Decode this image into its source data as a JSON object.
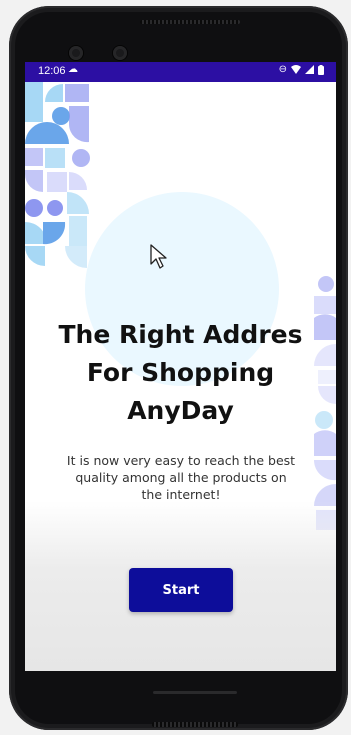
{
  "status_bar": {
    "time": "12:06",
    "left_icons": [
      "cloud-icon"
    ],
    "right_icons": [
      "do-not-disturb-icon",
      "wifi-icon",
      "signal-icon",
      "battery-icon"
    ],
    "background": "#2c0fa3"
  },
  "onboarding": {
    "title_lines": [
      "The Right Addres",
      "For Shopping",
      "AnyDay"
    ],
    "subtitle": "It is now very easy to reach the best quality among all the products on the internet!",
    "start_button_label": "Start"
  },
  "colors": {
    "accent": "#0d0d9a",
    "circle_background": "#eaf8ff",
    "decoration_purple": "#8e97f0",
    "decoration_blue": "#a7d8f5"
  }
}
